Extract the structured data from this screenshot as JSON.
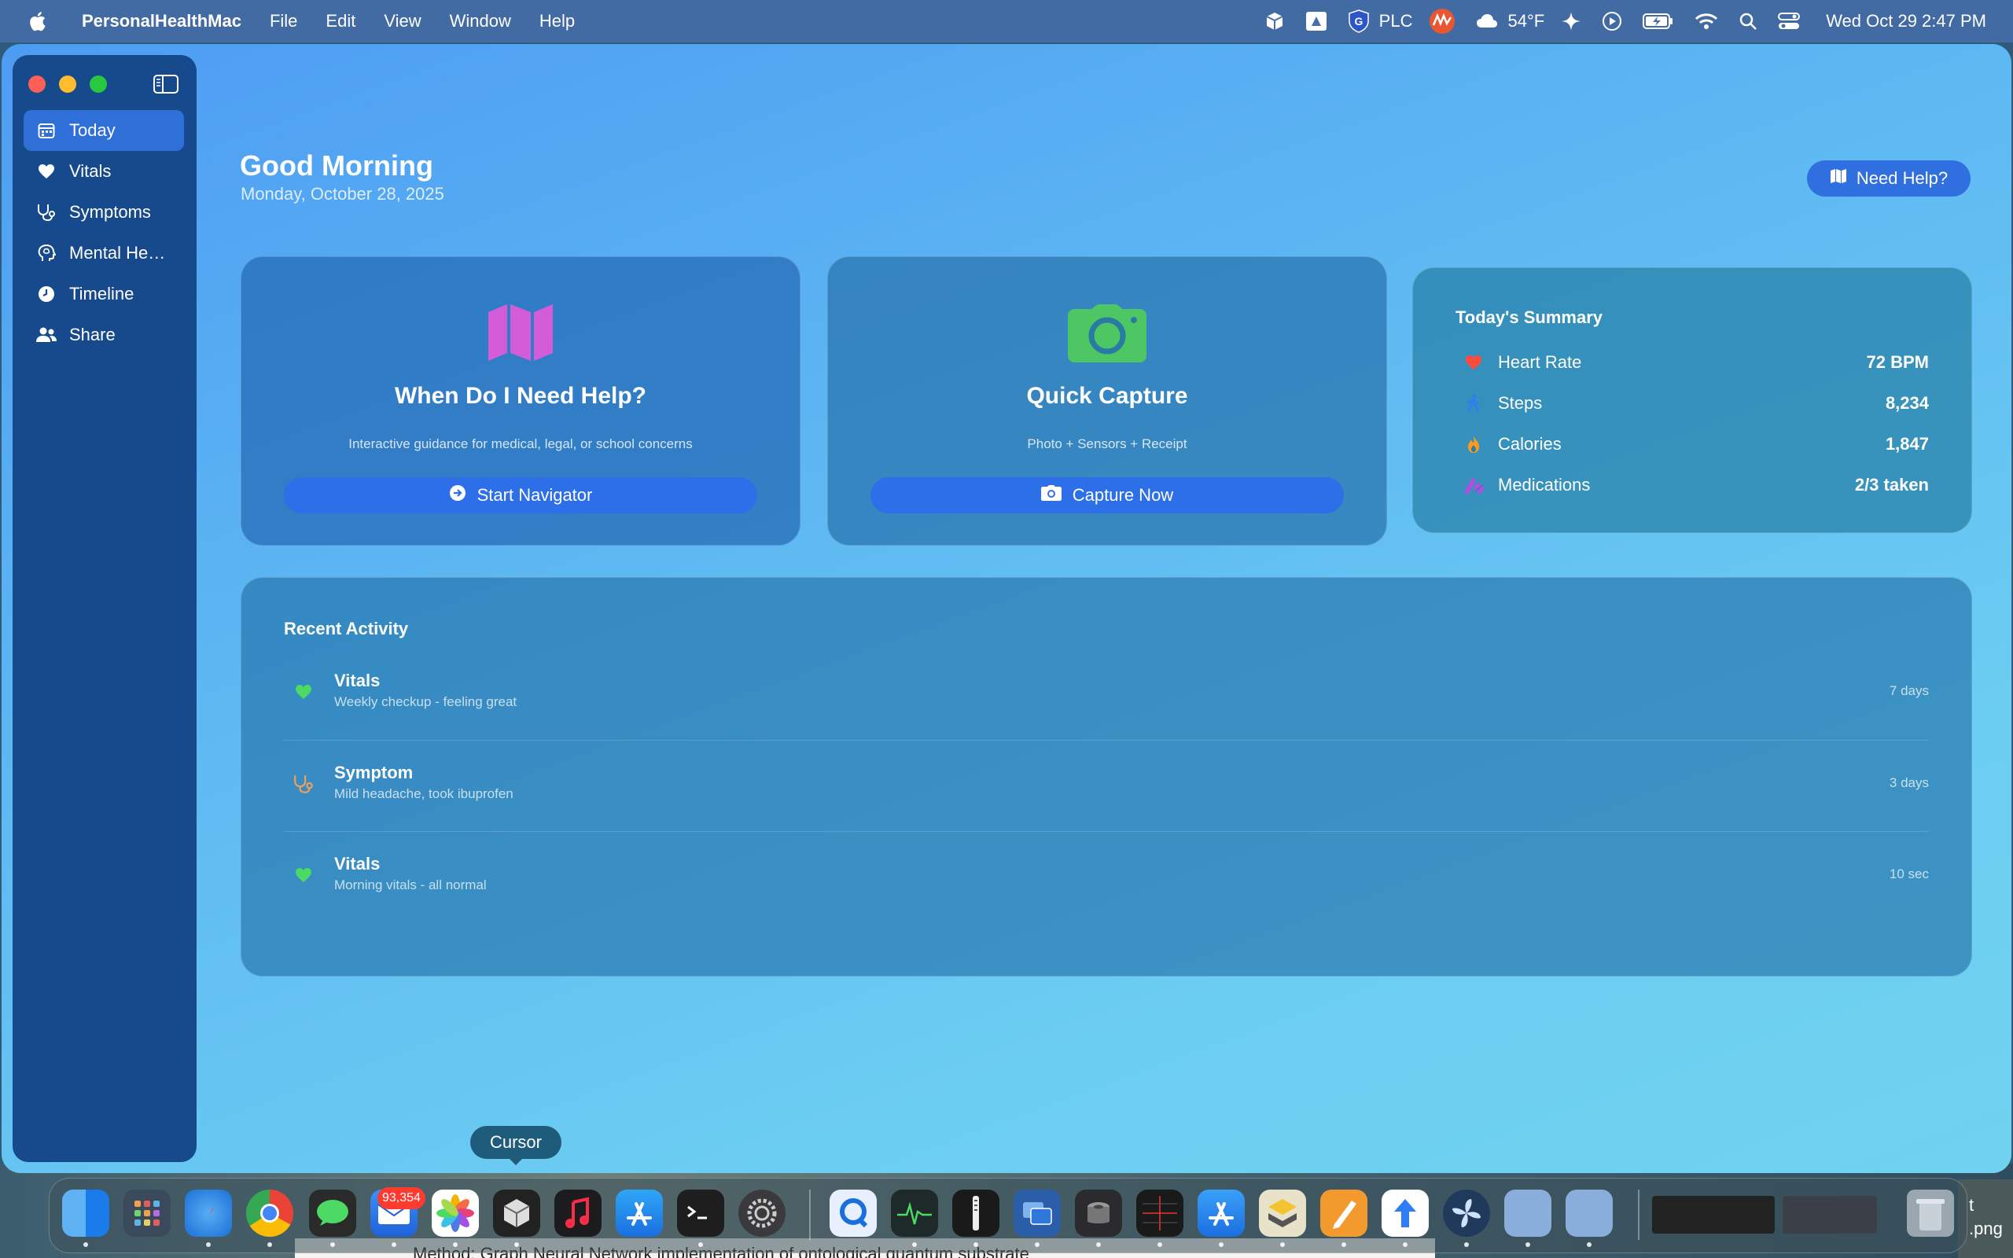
{
  "menubar": {
    "app_name": "PersonalHealthMac",
    "menus": [
      "File",
      "Edit",
      "View",
      "Window",
      "Help"
    ],
    "status": {
      "plc_label": "PLC",
      "weather": "54°F",
      "clock": "Wed Oct 29  2:47 PM"
    }
  },
  "sidebar": {
    "items": [
      {
        "label": "Today",
        "icon": "calendar-icon",
        "active": true
      },
      {
        "label": "Vitals",
        "icon": "heart-icon",
        "active": false
      },
      {
        "label": "Symptoms",
        "icon": "stethoscope-icon",
        "active": false
      },
      {
        "label": "Mental Health",
        "icon": "brain-head-icon",
        "active": false
      },
      {
        "label": "Timeline",
        "icon": "clock-icon",
        "active": false
      },
      {
        "label": "Share",
        "icon": "people-icon",
        "active": false
      }
    ]
  },
  "header": {
    "greeting": "Good Morning",
    "date": "Monday, October 28, 2025",
    "help_button": "Need Help?"
  },
  "cards": {
    "help": {
      "title": "When Do I Need Help?",
      "subtitle": "Interactive guidance for medical, legal, or school concerns",
      "button": "Start Navigator",
      "icon_color": "#d35cd9"
    },
    "capture": {
      "title": "Quick Capture",
      "subtitle": "Photo + Sensors + Receipt",
      "button": "Capture Now",
      "icon_color": "#4cc764"
    }
  },
  "summary": {
    "title": "Today's Summary",
    "rows": [
      {
        "label": "Heart Rate",
        "value": "72 BPM",
        "icon": "heart-icon",
        "color": "#ff4a3d"
      },
      {
        "label": "Steps",
        "value": "8,234",
        "icon": "walking-figure-icon",
        "color": "#2f7cf6"
      },
      {
        "label": "Calories",
        "value": "1,847",
        "icon": "flame-icon",
        "color": "#ff9a1f"
      },
      {
        "label": "Medications",
        "value": "2/3 taken",
        "icon": "pills-icon",
        "color": "#b14fe0"
      }
    ]
  },
  "activity": {
    "title": "Recent Activity",
    "rows": [
      {
        "title": "Vitals",
        "detail": "Weekly checkup - feeling great",
        "time": "7 days",
        "icon": "heart-icon"
      },
      {
        "title": "Symptom",
        "detail": "Mild headache, took ibuprofen",
        "time": "3 days",
        "icon": "stethoscope-icon"
      },
      {
        "title": "Vitals",
        "detail": "Morning vitals - all normal",
        "time": "10 sec",
        "icon": "heart-icon"
      }
    ]
  },
  "dock": {
    "mail_badge": "93,354",
    "tooltip": "Cursor"
  },
  "background": {
    "doc_text": "Method: Graph Neural Network implementation of ontological quantum substrate",
    "right_text_1": "t",
    "right_text_2": ".png"
  }
}
